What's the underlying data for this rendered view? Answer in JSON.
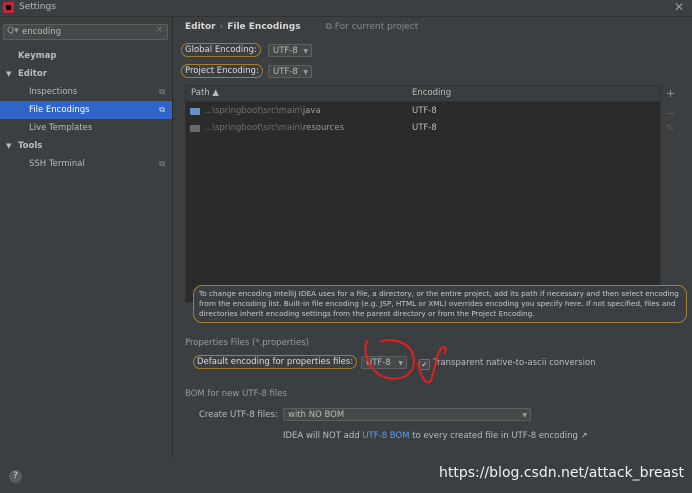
{
  "window": {
    "title": "Settings"
  },
  "search": {
    "value": "encoding"
  },
  "tree": [
    {
      "label": "Keymap",
      "level": 0,
      "bold": true
    },
    {
      "label": "Editor",
      "level": 0,
      "bold": true,
      "expanded": true
    },
    {
      "label": "Inspections",
      "level": 1
    },
    {
      "label": "File Encodings",
      "level": 1,
      "selected": true
    },
    {
      "label": "Live Templates",
      "level": 1
    },
    {
      "label": "Tools",
      "level": 0,
      "bold": true,
      "expanded": true
    },
    {
      "label": "SSH Terminal",
      "level": 1
    }
  ],
  "breadcrumb": {
    "parent": "Editor",
    "separator": "›",
    "current": "File Encodings",
    "scope": "For current project"
  },
  "global_encoding": {
    "label": "Global Encoding:",
    "value": "UTF-8"
  },
  "project_encoding": {
    "label": "Project Encoding:",
    "value": "UTF-8"
  },
  "table": {
    "headers": {
      "path": "Path ▲",
      "encoding": "Encoding"
    },
    "rows": [
      {
        "path_prefix": "...\\springboot\\src\\main\\",
        "path_tail": "java",
        "encoding": "UTF-8"
      },
      {
        "path_prefix": "...\\springboot\\src\\main\\",
        "path_tail": "resources",
        "encoding": "UTF-8"
      }
    ]
  },
  "info_text": "To change encoding IntelliJ IDEA uses for a file, a directory, or the entire project, add its path if necessary and then select encoding from the encoding list. Built-in file encoding (e.g. JSP, HTML or XML) overrides encoding you specify here. If not specified, files and directories inherit encoding settings from the parent directory or from the Project Encoding.",
  "properties": {
    "section": "Properties Files (*.properties)",
    "default_label": "Default encoding for properties files:",
    "value": "UTF-8",
    "transparent_label": "Transparent native-to-ascii conversion",
    "transparent_checked": true
  },
  "bom": {
    "section": "BOM for new UTF-8 files",
    "create_label": "Create UTF-8 files:",
    "create_value": "with NO BOM",
    "note_prefix": "IDEA will NOT add",
    "note_link": "UTF-8 BOM",
    "note_suffix": "to every created file in UTF-8 encoding ↗"
  },
  "watermark": "https://blog.csdn.net/attack_breast",
  "colors": {
    "accent": "#2f65ca",
    "highlight": "#a27d34",
    "annotation_red": "#e02020",
    "link": "#589df6"
  }
}
